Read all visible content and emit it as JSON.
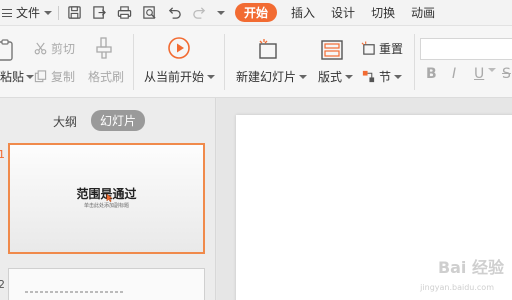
{
  "menu": {
    "file_label": "文件",
    "tabs": [
      "开始",
      "插入",
      "设计",
      "切换",
      "动画"
    ],
    "active_tab": "开始",
    "accent": "#f26b32"
  },
  "ribbon": {
    "paste_label": "粘贴",
    "cut_label": "剪切",
    "copy_label": "复制",
    "format_painter_label": "格式刷",
    "from_current_label": "从当前开始",
    "new_slide_label": "新建幻灯片",
    "layout_label": "版式",
    "reset_label": "重置",
    "section_label": "节",
    "bold_label": "B",
    "italic_label": "I",
    "underline_label": "U",
    "strike_label": "S"
  },
  "panel": {
    "outline_tab": "大纲",
    "slides_tab": "幻灯片",
    "slide1_num": "1",
    "slide2_num": "2",
    "slide1_title": "范围是通过",
    "slide1_subtitle": "单击此处添加副标题"
  },
  "watermark": {
    "text": "Bai 经验",
    "sub": "jingyan.baidu.com"
  }
}
